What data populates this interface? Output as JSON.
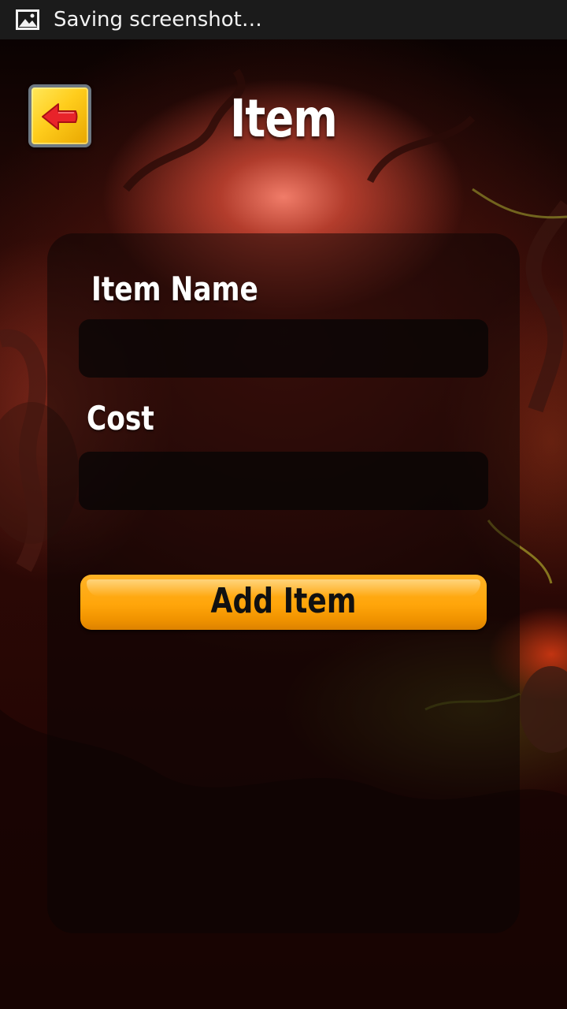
{
  "status_bar": {
    "icon": "image-icon",
    "text": "Saving screenshot…"
  },
  "header": {
    "back_icon": "arrow-left-icon",
    "title": "Item"
  },
  "form": {
    "item_name_label": "Item Name",
    "item_name_value": "",
    "cost_label": "Cost",
    "cost_value": "",
    "submit_label": "Add Item"
  },
  "colors": {
    "button_orange": "#ffa50a",
    "back_button_yellow": "#ffcd1c",
    "arrow_red": "#e8232a"
  }
}
